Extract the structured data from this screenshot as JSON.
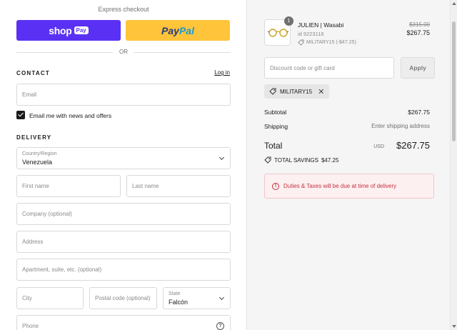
{
  "express": {
    "title": "Express checkout",
    "shop_word": "shop",
    "shop_pay_badge": "Pay",
    "paypal_part1": "Pay",
    "paypal_part2": "Pal",
    "or_text": "OR"
  },
  "contact": {
    "heading": "CONTACT",
    "login_link": "Log in",
    "email_placeholder": "Email",
    "newsletter_label": "Email me with news and offers",
    "newsletter_checked": true
  },
  "delivery": {
    "heading": "DELIVERY",
    "country_label": "Country/Region",
    "country_value": "Venezuela",
    "first_name_placeholder": "First name",
    "last_name_placeholder": "Last name",
    "company_placeholder": "Company (optional)",
    "address_placeholder": "Address",
    "apartment_placeholder": "Apartment, suite, etc. (optional)",
    "city_placeholder": "City",
    "postal_placeholder": "Postal code (optional)",
    "state_label": "State",
    "state_value": "Falcón",
    "phone_placeholder": "Phone"
  },
  "order": {
    "item": {
      "quantity": "1",
      "name": "JULIEN | Wasabi",
      "id_text": "id 9223116",
      "discount_text": "MILITARY15 (-$47.25)",
      "price_original": "$315.00",
      "price_current": "$267.75"
    },
    "discount_placeholder": "Discount code or gift card",
    "apply_label": "Apply",
    "applied_code": "MILITARY15",
    "subtotal_label": "Subtotal",
    "subtotal_value": "$267.75",
    "shipping_label": "Shipping",
    "shipping_value": "Enter shipping address",
    "total_label": "Total",
    "total_currency": "USD",
    "total_value": "$267.75",
    "savings_label": "TOTAL SAVINGS",
    "savings_value": "$47.25",
    "alert_text": "Duties & Taxes will be due at time of delivery"
  },
  "colors": {
    "shop_pay": "#5a31f4",
    "paypal": "#ffc439",
    "alert": "#c6303e"
  }
}
